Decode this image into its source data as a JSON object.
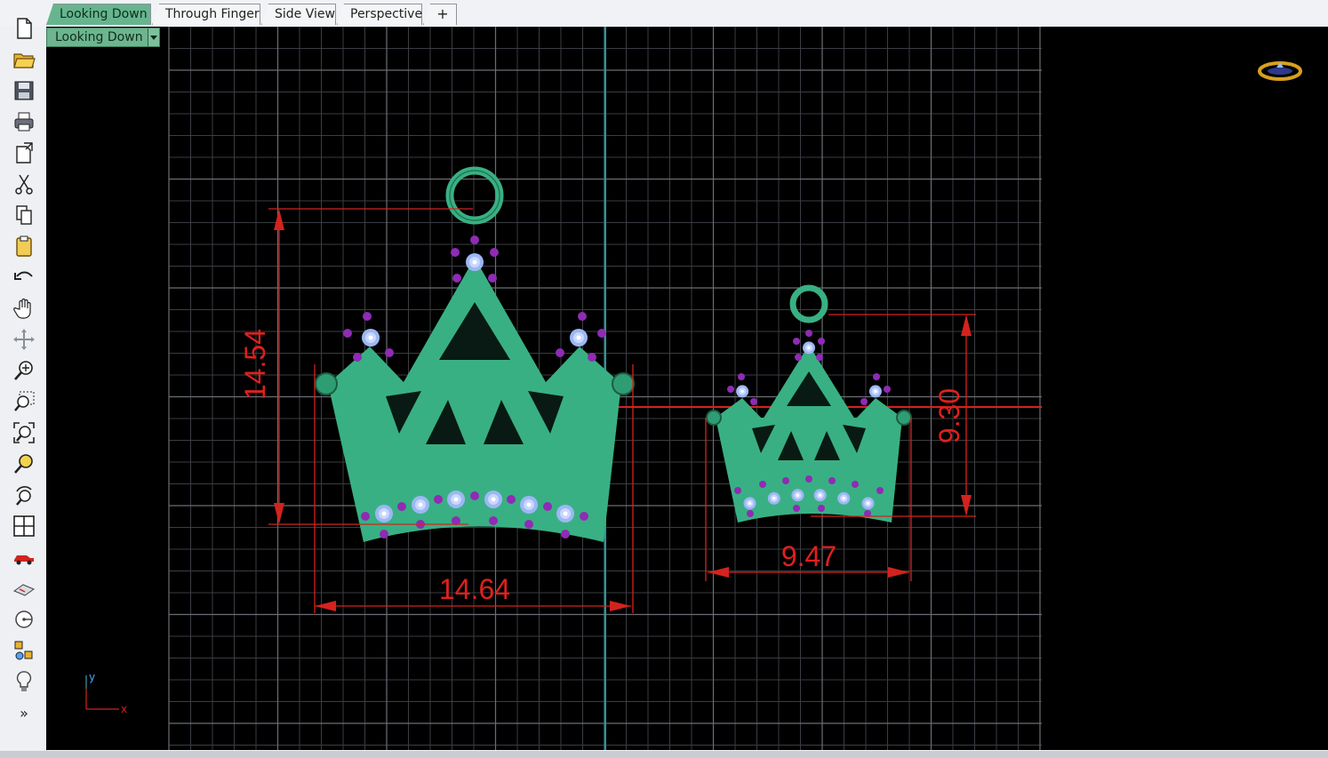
{
  "tabs": [
    {
      "label": "Looking Down",
      "active": true
    },
    {
      "label": "Through Finger",
      "active": false
    },
    {
      "label": "Side View",
      "active": false
    },
    {
      "label": "Perspective",
      "active": false
    }
  ],
  "add_tab_label": "+",
  "viewport": {
    "label": "Looking Down",
    "dims_left": {
      "height": "14.54",
      "width": "14.64"
    },
    "dims_right": {
      "height": "9.30",
      "width": "9.47"
    },
    "axis": {
      "x": "x",
      "y": "y"
    }
  },
  "toolbar_icons": [
    "new-file-icon",
    "open-folder-icon",
    "save-icon",
    "print-icon",
    "import-icon",
    "cut-icon",
    "copy-icon",
    "paste-icon",
    "undo-icon",
    "pan-hand-icon",
    "rotate-view-icon",
    "zoom-icon",
    "zoom-window-icon",
    "zoom-extents-icon",
    "zoom-selected-icon",
    "rotate-camera-icon",
    "four-viewports-icon",
    "car-icon",
    "plane-icon",
    "circle-target-icon",
    "shapes-icon",
    "lightbulb-icon",
    "more-icon"
  ],
  "colors": {
    "grid": "#3a3d42",
    "crown": "#39b083",
    "gem": "#9db7f4",
    "prong": "#8f2bb5",
    "dimension": "#e0201c",
    "active_tab": "#66b58e"
  }
}
